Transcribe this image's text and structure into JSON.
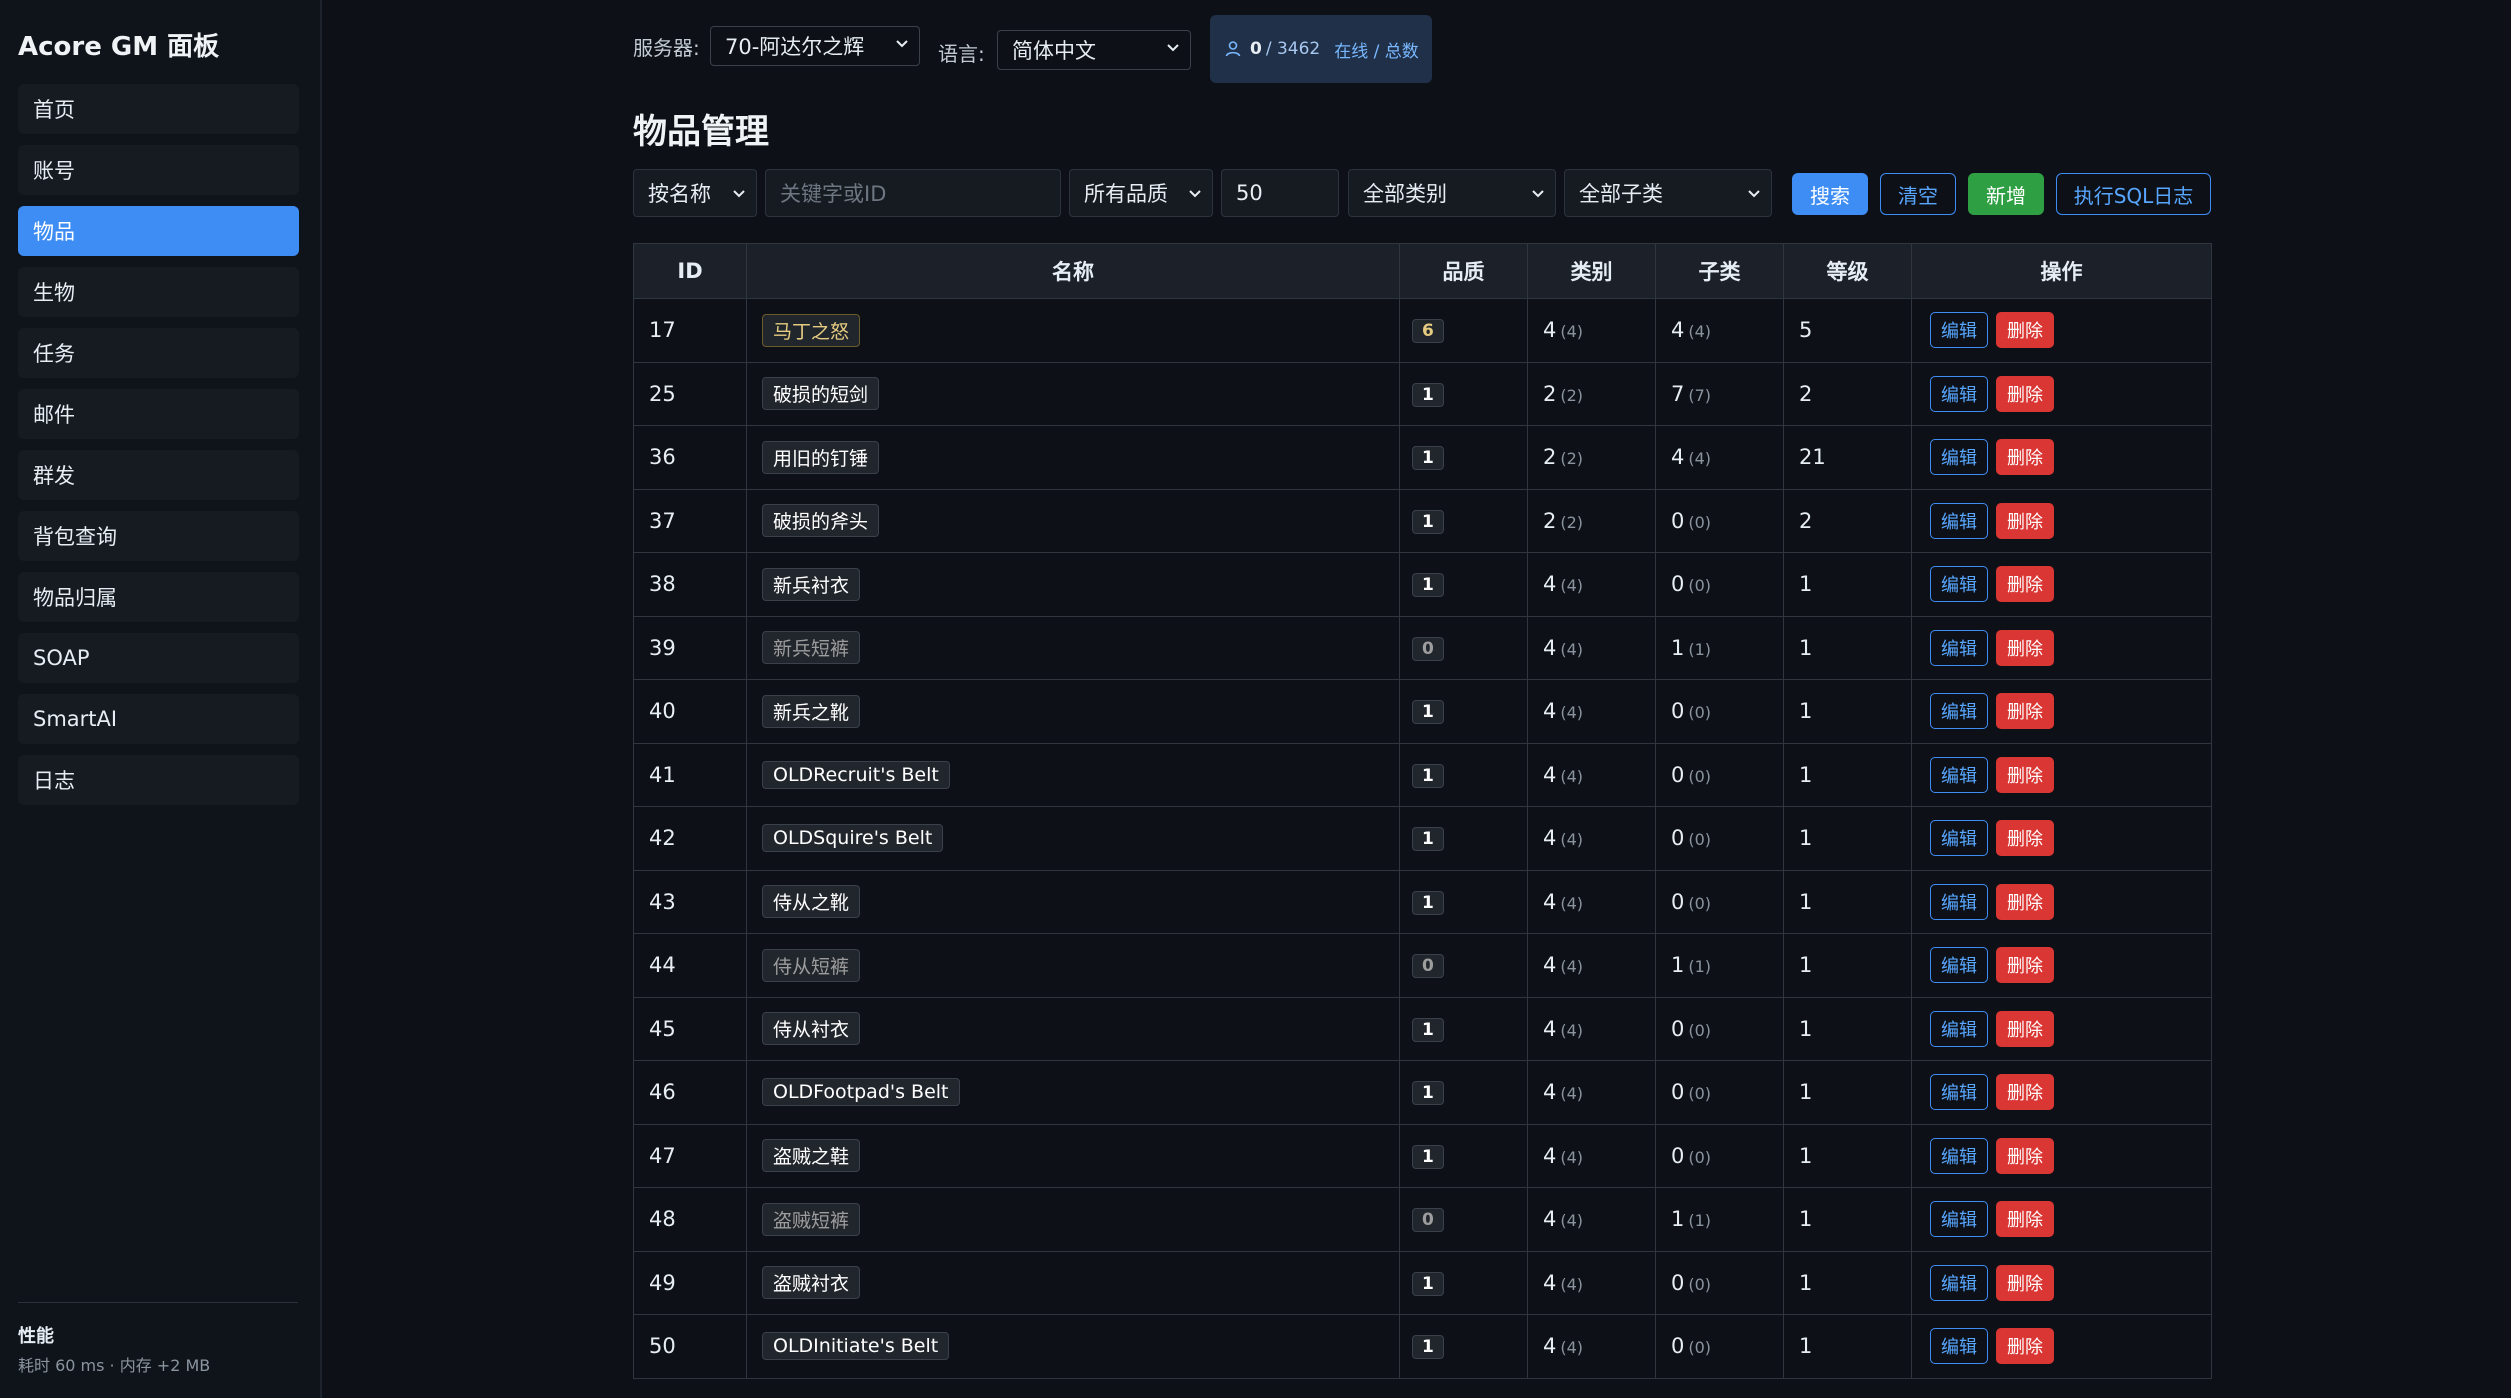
{
  "app": {
    "title": "Acore GM 面板"
  },
  "sidebar": {
    "items": [
      {
        "label": "首页"
      },
      {
        "label": "账号"
      },
      {
        "label": "物品",
        "active": true
      },
      {
        "label": "生物"
      },
      {
        "label": "任务"
      },
      {
        "label": "邮件"
      },
      {
        "label": "群发"
      },
      {
        "label": "背包查询"
      },
      {
        "label": "物品归属"
      },
      {
        "label": "SOAP"
      },
      {
        "label": "SmartAI"
      },
      {
        "label": "日志"
      }
    ],
    "perf": {
      "title": "性能",
      "text": "耗时 60 ms · 内存 +2 MB"
    }
  },
  "topbar": {
    "server_label": "服务器:",
    "server_value": "70-阿达尔之辉",
    "lang_label": "语言:",
    "lang_value": "简体中文",
    "online_count": "0",
    "online_total": "/ 3462",
    "online_text": "在线 / 总数"
  },
  "page": {
    "title": "物品管理"
  },
  "filters": {
    "search_mode": "按名称",
    "keyword_placeholder": "关键字或ID",
    "quality": "所有品质",
    "limit": "50",
    "category": "全部类别",
    "subcategory": "全部子类",
    "search_button": "搜索",
    "clear_button": "清空",
    "add_button": "新增",
    "sql_log_button": "执行SQL日志"
  },
  "colors": {
    "accent": "#3d8df5",
    "danger": "#da3633",
    "success": "#2ea043",
    "quality_poor": "#9d9d9d",
    "quality_common": "#ffffff",
    "quality_artifact": "#e6cc80"
  },
  "table": {
    "headers": [
      "ID",
      "名称",
      "品质",
      "类别",
      "子类",
      "等级",
      "操作"
    ],
    "edit_label": "编辑",
    "delete_label": "删除",
    "rows": [
      {
        "id": "17",
        "name": "马丁之怒",
        "quality": "6",
        "cls": "4",
        "cls_sub": "(4)",
        "subcls": "4",
        "subcls_sub": "(4)",
        "level": "5"
      },
      {
        "id": "25",
        "name": "破损的短剑",
        "quality": "1",
        "cls": "2",
        "cls_sub": "(2)",
        "subcls": "7",
        "subcls_sub": "(7)",
        "level": "2"
      },
      {
        "id": "36",
        "name": "用旧的钉锤",
        "quality": "1",
        "cls": "2",
        "cls_sub": "(2)",
        "subcls": "4",
        "subcls_sub": "(4)",
        "level": "21"
      },
      {
        "id": "37",
        "name": "破损的斧头",
        "quality": "1",
        "cls": "2",
        "cls_sub": "(2)",
        "subcls": "0",
        "subcls_sub": "(0)",
        "level": "2"
      },
      {
        "id": "38",
        "name": "新兵衬衣",
        "quality": "1",
        "cls": "4",
        "cls_sub": "(4)",
        "subcls": "0",
        "subcls_sub": "(0)",
        "level": "1"
      },
      {
        "id": "39",
        "name": "新兵短裤",
        "quality": "0",
        "cls": "4",
        "cls_sub": "(4)",
        "subcls": "1",
        "subcls_sub": "(1)",
        "level": "1"
      },
      {
        "id": "40",
        "name": "新兵之靴",
        "quality": "1",
        "cls": "4",
        "cls_sub": "(4)",
        "subcls": "0",
        "subcls_sub": "(0)",
        "level": "1"
      },
      {
        "id": "41",
        "name": "OLDRecruit's Belt",
        "quality": "1",
        "cls": "4",
        "cls_sub": "(4)",
        "subcls": "0",
        "subcls_sub": "(0)",
        "level": "1"
      },
      {
        "id": "42",
        "name": "OLDSquire's Belt",
        "quality": "1",
        "cls": "4",
        "cls_sub": "(4)",
        "subcls": "0",
        "subcls_sub": "(0)",
        "level": "1"
      },
      {
        "id": "43",
        "name": "侍从之靴",
        "quality": "1",
        "cls": "4",
        "cls_sub": "(4)",
        "subcls": "0",
        "subcls_sub": "(0)",
        "level": "1"
      },
      {
        "id": "44",
        "name": "侍从短裤",
        "quality": "0",
        "cls": "4",
        "cls_sub": "(4)",
        "subcls": "1",
        "subcls_sub": "(1)",
        "level": "1"
      },
      {
        "id": "45",
        "name": "侍从衬衣",
        "quality": "1",
        "cls": "4",
        "cls_sub": "(4)",
        "subcls": "0",
        "subcls_sub": "(0)",
        "level": "1"
      },
      {
        "id": "46",
        "name": "OLDFootpad's Belt",
        "quality": "1",
        "cls": "4",
        "cls_sub": "(4)",
        "subcls": "0",
        "subcls_sub": "(0)",
        "level": "1"
      },
      {
        "id": "47",
        "name": "盗贼之鞋",
        "quality": "1",
        "cls": "4",
        "cls_sub": "(4)",
        "subcls": "0",
        "subcls_sub": "(0)",
        "level": "1"
      },
      {
        "id": "48",
        "name": "盗贼短裤",
        "quality": "0",
        "cls": "4",
        "cls_sub": "(4)",
        "subcls": "1",
        "subcls_sub": "(1)",
        "level": "1"
      },
      {
        "id": "49",
        "name": "盗贼衬衣",
        "quality": "1",
        "cls": "4",
        "cls_sub": "(4)",
        "subcls": "0",
        "subcls_sub": "(0)",
        "level": "1"
      },
      {
        "id": "50",
        "name": "OLDInitiate's Belt",
        "quality": "1",
        "cls": "4",
        "cls_sub": "(4)",
        "subcls": "0",
        "subcls_sub": "(0)",
        "level": "1"
      }
    ]
  }
}
